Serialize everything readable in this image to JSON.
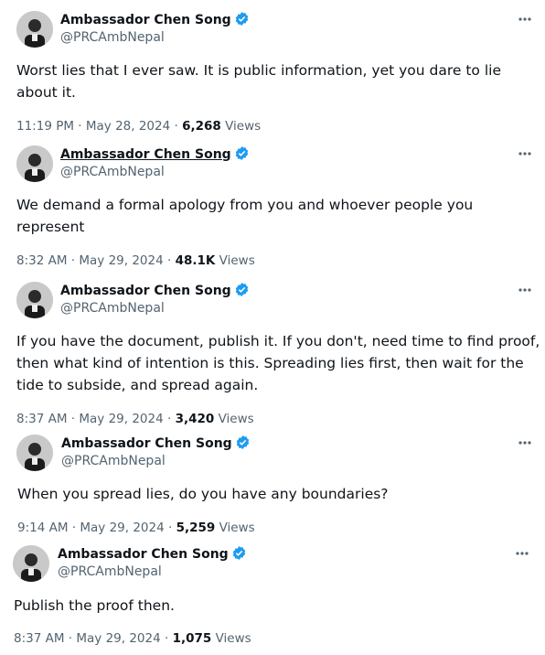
{
  "posts": [
    {
      "author": "Ambassador Chen Song",
      "handle": "@PRCAmbNepal",
      "text": "Worst lies that I ever saw. It is public information, yet you dare to lie\nabout it.",
      "time": "11:19 PM",
      "date": "May 28, 2024",
      "views_count": "6,268",
      "views_label": "Views"
    },
    {
      "author": "Ambassador Chen Song",
      "handle": "@PRCAmbNepal",
      "text": "We demand a formal apology from you and whoever people you\nrepresent",
      "time": "8:32 AM",
      "date": "May 29, 2024",
      "views_count": "48.1K",
      "views_label": "Views"
    },
    {
      "author": "Ambassador Chen Song",
      "handle": "@PRCAmbNepal",
      "text": "If you have the document, publish it. If you don't, need time to find proof,\nthen what kind of intention is this. Spreading lies first, then wait for the\ntide to subside, and spread again.",
      "time": "8:37 AM",
      "date": "May 29, 2024",
      "views_count": "3,420",
      "views_label": "Views"
    },
    {
      "author": "Ambassador Chen Song",
      "handle": "@PRCAmbNepal",
      "text": "When you spread lies, do you have any boundaries?",
      "time": "9:14 AM",
      "date": "May 29, 2024",
      "views_count": "5,259",
      "views_label": "Views"
    },
    {
      "author": "Ambassador Chen Song",
      "handle": "@PRCAmbNepal",
      "text": "Publish the proof then.",
      "time": "8:37 AM",
      "date": "May 29, 2024",
      "views_count": "1,075",
      "views_label": "Views"
    }
  ],
  "separator": " · ",
  "icons": {
    "verified": "verified-badge-icon",
    "more": "more-options-icon"
  },
  "colors": {
    "verified": "#1d9bf0",
    "secondary_text": "#536471",
    "primary_text": "#0f1419"
  }
}
